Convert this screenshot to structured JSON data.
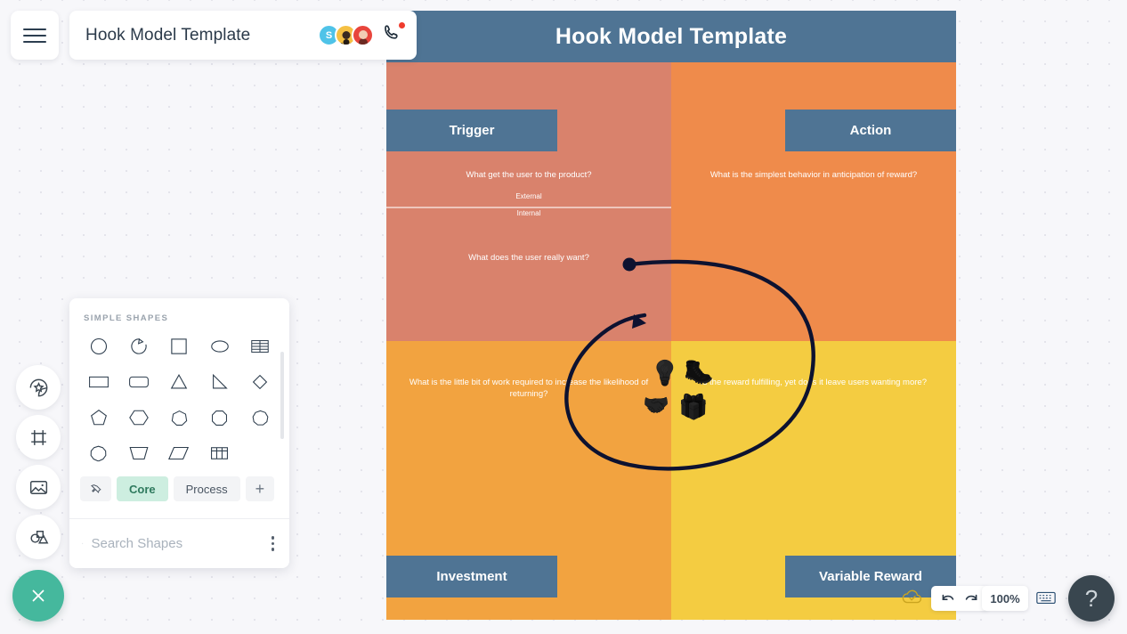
{
  "topbar": {
    "hamburger_icon": "hamburger-menu-icon",
    "doc_title": "Hook Model Template",
    "avatars": [
      {
        "initial": "S",
        "color": "#4fc3e8"
      },
      {
        "initial": "",
        "color": "#f5c043"
      },
      {
        "initial": "",
        "color": "#e8453c"
      }
    ],
    "call_icon": "phone-call-icon",
    "call_badge": true
  },
  "board": {
    "header_title": "Hook Model Template",
    "header_color": "#4f7494",
    "quadrants": [
      {
        "key": "trigger",
        "label": "Trigger",
        "bg": "#d9826c",
        "question_a": "What get the user to the product?",
        "divider_top": "External",
        "divider_bottom": "Internal",
        "question_b": "What does the user really want?"
      },
      {
        "key": "action",
        "label": "Action",
        "bg": "#ef8b4b",
        "question_a": "What is the simplest behavior in anticipation of reward?"
      },
      {
        "key": "investment",
        "label": "Investment",
        "bg": "#f2a340",
        "question_a": "What is the little bit of work required to increase the likelihood of returning?"
      },
      {
        "key": "variable-reward",
        "label": "Variable Reward",
        "bg": "#f4cc41",
        "question_a": "Is the reward fulfilling, yet does it leave users wanting more?"
      }
    ],
    "center_icons": [
      {
        "name": "lightbulb-icon",
        "glyph": "💡"
      },
      {
        "name": "hiker-icon",
        "glyph": "🥾"
      },
      {
        "name": "handshake-icon",
        "glyph": "🤝"
      },
      {
        "name": "gift-icon",
        "glyph": "🎁"
      }
    ]
  },
  "sidebar": {
    "items": [
      {
        "name": "sticker-icon"
      },
      {
        "name": "frame-icon"
      },
      {
        "name": "image-icon"
      },
      {
        "name": "shapes-icon"
      }
    ],
    "close_fab": {
      "name": "close-icon",
      "color": "#45b89d"
    }
  },
  "shapes_panel": {
    "section_title": "SIMPLE SHAPES",
    "shapes": [
      "circle-shape",
      "arc-shape",
      "square-shape",
      "ellipse-shape",
      "list-table-shape",
      "rectangle-shape",
      "rounded-rectangle-shape",
      "triangle-shape",
      "right-triangle-shape",
      "diamond-shape",
      "pentagon-shape",
      "hexagon-shape",
      "heptagon-shape",
      "octagon-shape",
      "nonagon-shape",
      "decagon-shape",
      "trapezoid-shape",
      "parallelogram-shape",
      "table-shape"
    ],
    "tabs": [
      {
        "label": "",
        "name": "pin-tab",
        "icon": "pin-icon",
        "active": false
      },
      {
        "label": "Core",
        "name": "core-tab",
        "active": true
      },
      {
        "label": "Process",
        "name": "process-tab",
        "active": false
      },
      {
        "label": "+",
        "name": "add-tab",
        "active": false
      }
    ],
    "search_placeholder": "Search Shapes",
    "search_value": "",
    "more_icon": "more-vertical-icon"
  },
  "bottom_toolbar": {
    "cloud_icon": "cloud-saved-icon",
    "undo_icon": "undo-icon",
    "redo_icon": "redo-icon",
    "zoom_level": "100%",
    "keyboard_icon": "keyboard-icon",
    "help_label": "?"
  }
}
